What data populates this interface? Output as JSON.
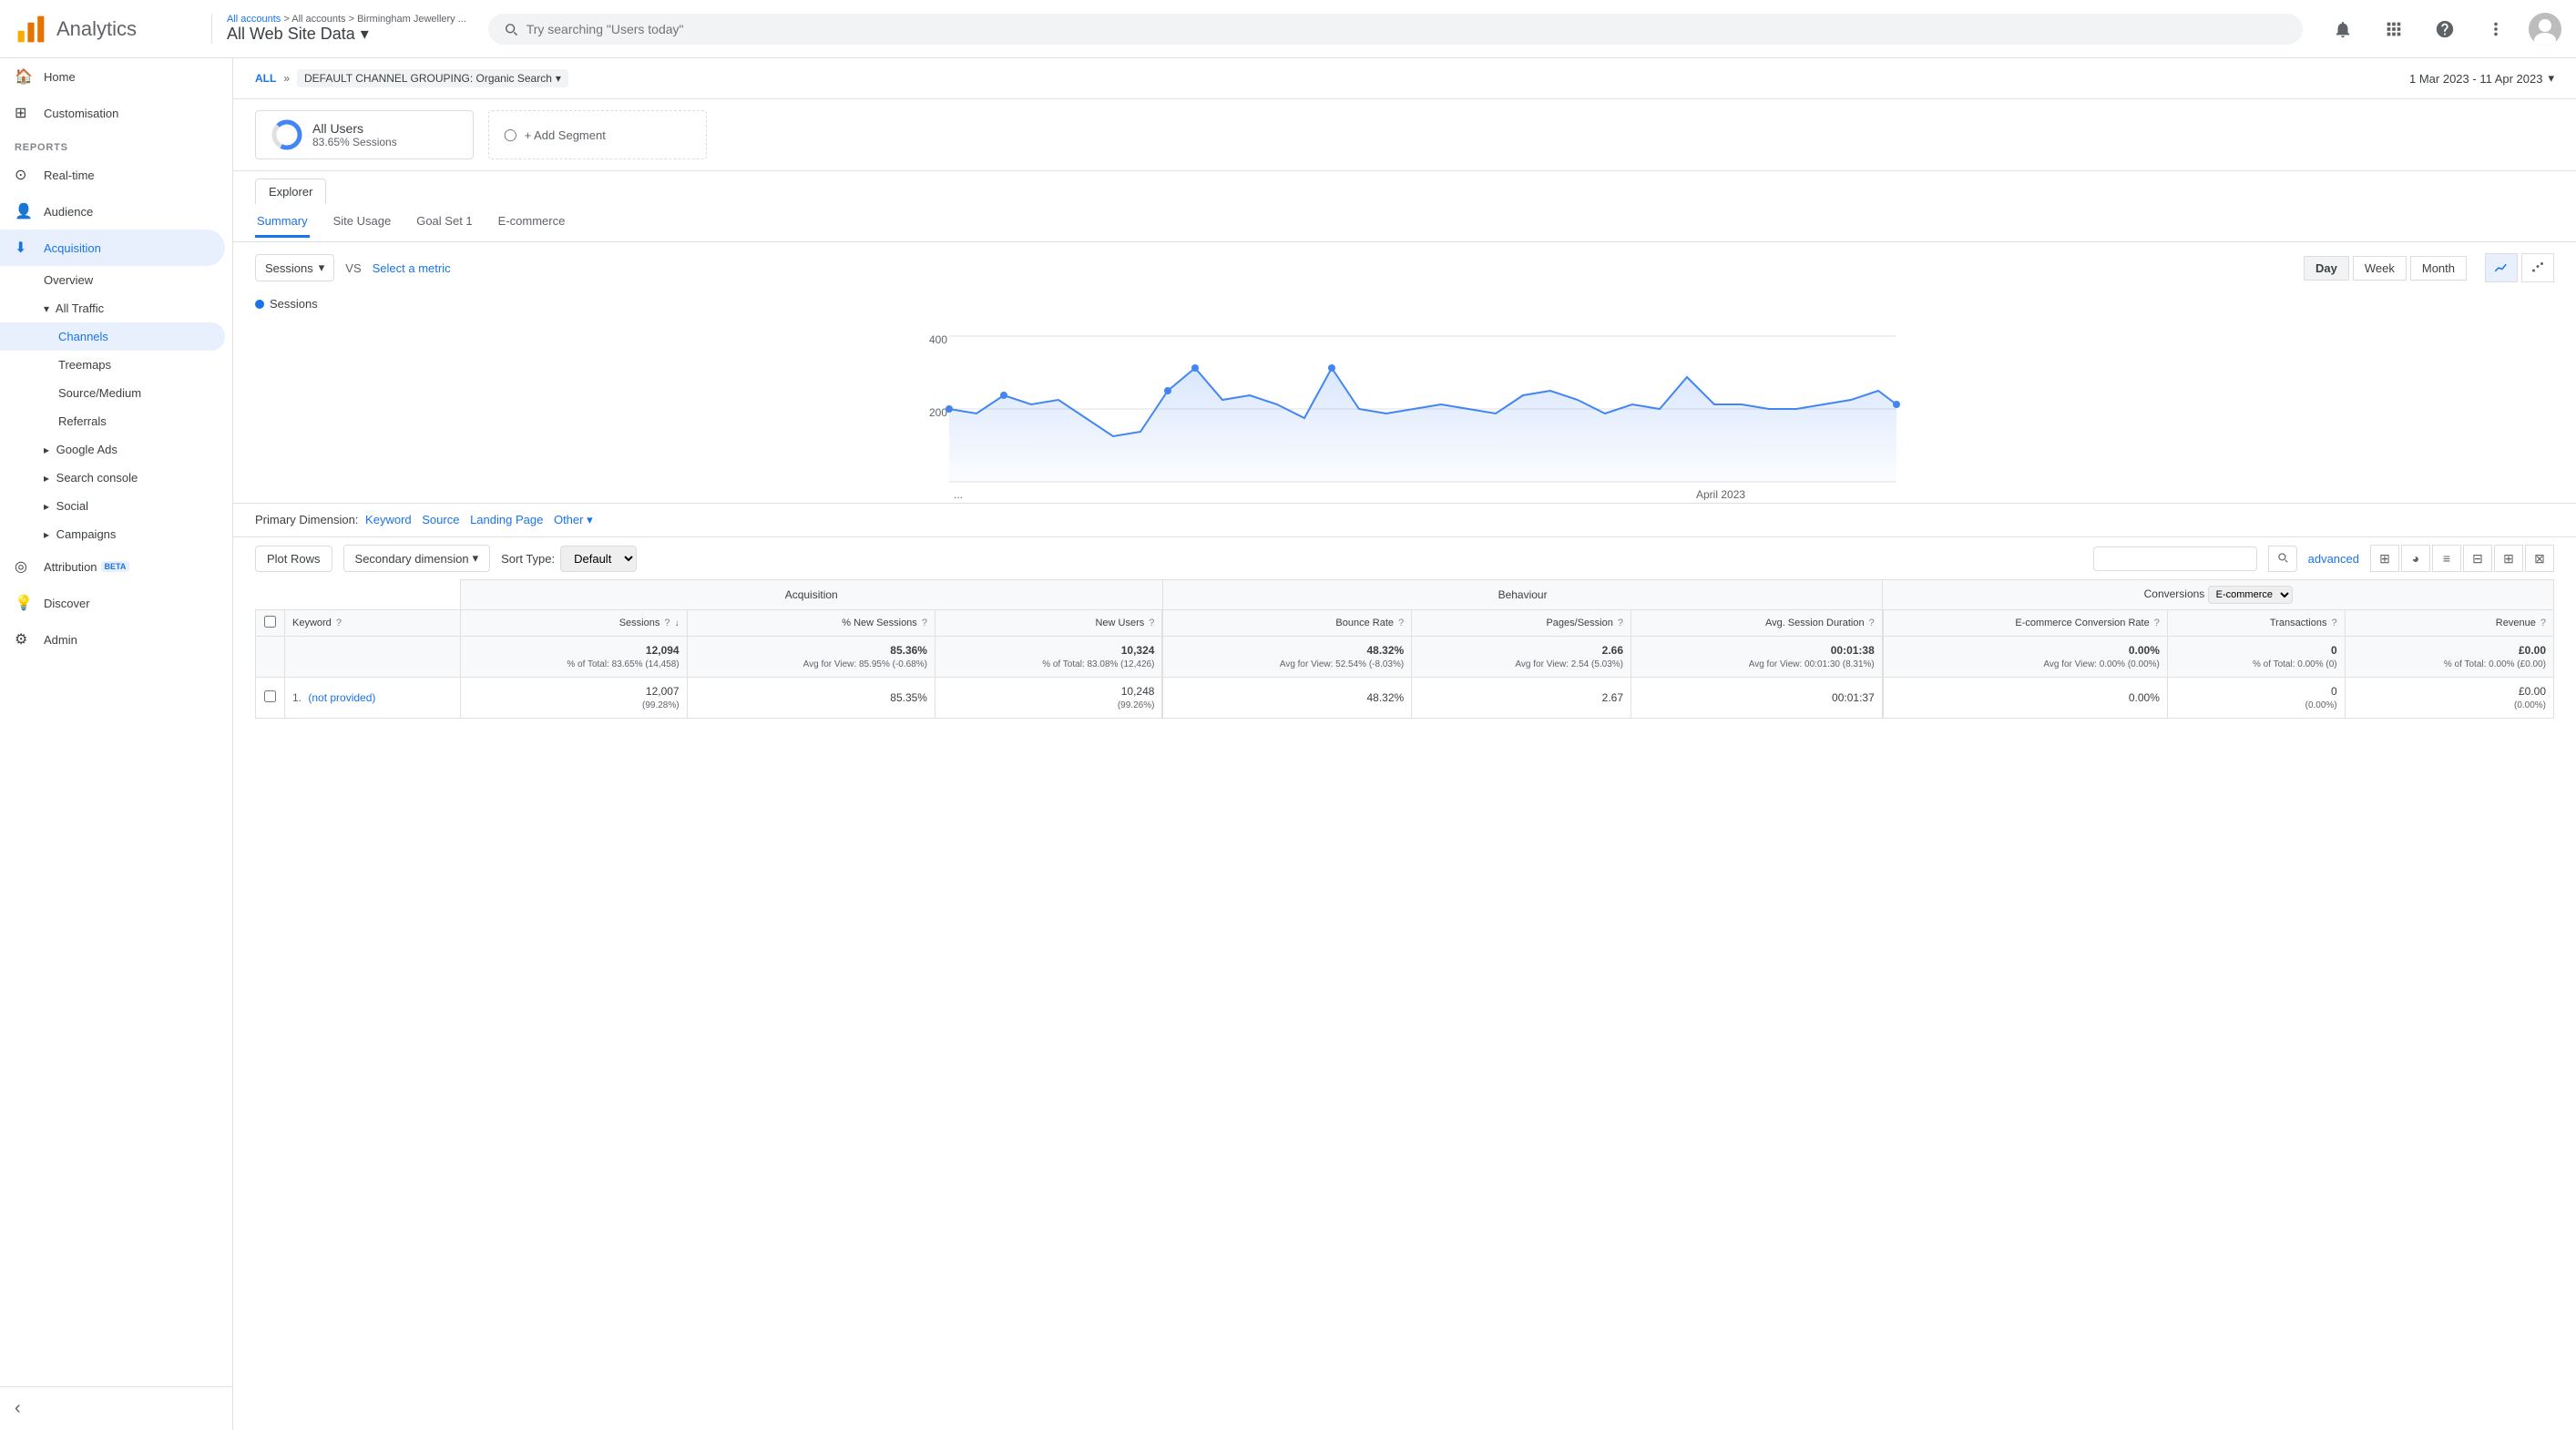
{
  "header": {
    "logo_text": "Analytics",
    "breadcrumb": "All accounts > Birmingham Jewellery ...",
    "property": "All Web Site Data",
    "search_placeholder": "Try searching \"Users today\"",
    "date_range": "1 Mar 2023 - 11 Apr 2023"
  },
  "sidebar": {
    "home": "Home",
    "customisation": "Customisation",
    "reports_label": "REPORTS",
    "realtime": "Real-time",
    "audience": "Audience",
    "acquisition": "Acquisition",
    "acquisition_items": [
      {
        "label": "Overview"
      },
      {
        "label": "All Traffic",
        "expanded": true,
        "sub": [
          {
            "label": "Channels",
            "active": true
          },
          {
            "label": "Treemaps"
          },
          {
            "label": "Source/Medium"
          },
          {
            "label": "Referrals"
          }
        ]
      },
      {
        "label": "Google Ads"
      },
      {
        "label": "Search console"
      },
      {
        "label": "Social"
      },
      {
        "label": "Campaigns"
      }
    ],
    "attribution": "Attribution",
    "attribution_badge": "BETA",
    "discover": "Discover",
    "admin": "Admin"
  },
  "filter_bar": {
    "all_label": "ALL",
    "separator": "»",
    "channel_label": "DEFAULT CHANNEL GROUPING: Organic Search"
  },
  "segments": {
    "all_users": {
      "name": "All Users",
      "sub": "83.65% Sessions"
    },
    "add_segment": "+ Add Segment"
  },
  "tabs": {
    "explorer": "Explorer",
    "sub_tabs": [
      "Summary",
      "Site Usage",
      "Goal Set 1",
      "E-commerce"
    ],
    "active_sub": "Summary"
  },
  "chart": {
    "metric": "Sessions",
    "vs_label": "VS",
    "select_metric": "Select a metric",
    "legend": "Sessions",
    "time_buttons": [
      "Day",
      "Week",
      "Month"
    ],
    "active_time": "Day",
    "y_axis": [
      400,
      200
    ],
    "april_label": "April 2023"
  },
  "table": {
    "primary_dim_label": "Primary Dimension:",
    "dim_keyword": "Keyword",
    "dim_source": "Source",
    "dim_landing": "Landing Page",
    "dim_other": "Other",
    "plot_rows": "Plot Rows",
    "secondary_dim": "Secondary dimension",
    "sort_type_label": "Sort Type:",
    "sort_default": "Default",
    "advanced": "advanced",
    "group_headers": [
      {
        "label": "Acquisition",
        "colspan": 3
      },
      {
        "label": "Behaviour",
        "colspan": 3
      },
      {
        "label": "Conversions",
        "colspan": 3,
        "has_select": true,
        "select_val": "E-commerce"
      }
    ],
    "col_headers": [
      {
        "label": "Keyword",
        "help": true,
        "left": true
      },
      {
        "label": "Sessions",
        "help": true,
        "sort": true
      },
      {
        "label": "% New Sessions",
        "help": true
      },
      {
        "label": "New Users",
        "help": true
      },
      {
        "label": "Bounce Rate",
        "help": true
      },
      {
        "label": "Pages/Session",
        "help": true
      },
      {
        "label": "Avg. Session Duration",
        "help": true
      },
      {
        "label": "E-commerce Conversion Rate",
        "help": true
      },
      {
        "label": "Transactions",
        "help": true
      },
      {
        "label": "Revenue",
        "help": true
      }
    ],
    "total_row": {
      "keyword": "",
      "sessions": "12,094",
      "sessions_sub": "% of Total: 83.65% (14,458)",
      "pct_new": "85.36%",
      "pct_new_sub": "Avg for View: 85.95% (-0.68%)",
      "new_users": "10,324",
      "new_users_sub": "% of Total: 83.08% (12,426)",
      "bounce_rate": "48.32%",
      "bounce_sub": "Avg for View: 52.54% (-8.03%)",
      "pages_session": "2.66",
      "pages_sub": "Avg for View: 2.54 (5.03%)",
      "avg_duration": "00:01:38",
      "avg_dur_sub": "Avg for View: 00:01:30 (8.31%)",
      "ecomm_rate": "0.00%",
      "ecomm_sub": "Avg for View: 0.00% (0.00%)",
      "transactions": "0",
      "trans_sub": "% of Total: 0.00% (0)",
      "revenue": "£0.00",
      "rev_sub": "% of Total: 0.00% (£0.00)"
    },
    "data_rows": [
      {
        "num": "1.",
        "keyword": "(not provided)",
        "sessions": "12,007",
        "pct_new": "85.35%",
        "pct_new_sub": "",
        "new_users": "10,248",
        "new_users_sub": "(99.26%)",
        "bounce_rate": "48.32%",
        "pages_session": "2.67",
        "avg_duration": "00:01:37",
        "ecomm_rate": "0.00%",
        "transactions": "0",
        "trans_sub": "(0.00%)",
        "revenue": "£0.00",
        "rev_sub": "(0.00%)",
        "sessions_sub": "(99.28%)"
      }
    ]
  }
}
